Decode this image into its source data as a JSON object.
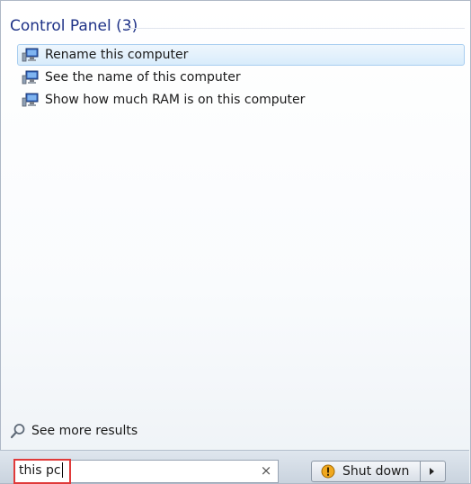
{
  "section": {
    "header": "Control Panel (3)"
  },
  "results": [
    {
      "label": "Rename this computer",
      "icon": "control-panel-system-icon",
      "selected": true
    },
    {
      "label": "See the name of this computer",
      "icon": "control-panel-system-icon",
      "selected": false
    },
    {
      "label": "Show how much RAM is on this computer",
      "icon": "control-panel-system-icon",
      "selected": false
    }
  ],
  "see_more": {
    "label": "See more results",
    "icon": "magnifier-icon"
  },
  "search": {
    "value": "this pc",
    "clear_icon": "×"
  },
  "shutdown": {
    "label": "Shut down",
    "icon": "uac-shield-icon",
    "arrow_icon": "right-arrow-icon"
  },
  "colors": {
    "header": "#1e3287",
    "selection": "#d9ecfb",
    "highlight_box": "#e03a3a"
  }
}
